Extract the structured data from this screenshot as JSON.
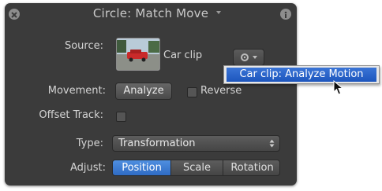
{
  "window": {
    "title": "Circle: Match Move"
  },
  "source": {
    "label": "Source:",
    "clip_name": "Car clip"
  },
  "movement": {
    "label": "Movement:",
    "analyze_label": "Analyze",
    "reverse_label": "Reverse",
    "reverse_checked": false
  },
  "offset_track": {
    "label": "Offset Track:",
    "checked": false
  },
  "type": {
    "label": "Type:",
    "selected": "Transformation"
  },
  "adjust": {
    "label": "Adjust:",
    "segments": [
      "Position",
      "Scale",
      "Rotation"
    ],
    "selected": "Position"
  },
  "dropdown_menu": {
    "items": [
      "Car clip: Analyze Motion"
    ],
    "highlighted": "Car clip: Analyze Motion"
  },
  "colors": {
    "panel_bg": "#3b3b3b",
    "accent": "#2f6bc4",
    "menu_bg": "#e7e7e7"
  }
}
